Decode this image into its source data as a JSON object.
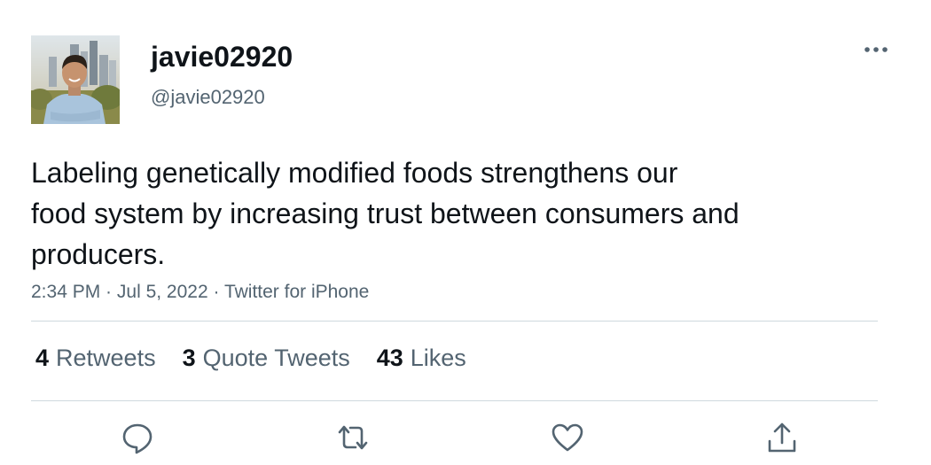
{
  "author": {
    "display_name": "javie02920",
    "handle": "@javie02920"
  },
  "tweet": {
    "text_lines": [
      "Labeling genetically modified foods strengthens our",
      "food system by increasing trust between consumers and",
      "producers."
    ],
    "time": "2:34 PM",
    "date": "Jul 5, 2022",
    "source": "Twitter for iPhone",
    "separator": " · "
  },
  "stats": {
    "retweets": {
      "count": "4",
      "label": "Retweets"
    },
    "quotes": {
      "count": "3",
      "label": "Quote Tweets"
    },
    "likes": {
      "count": "43",
      "label": "Likes"
    }
  },
  "actions": [
    "reply-icon",
    "retweet-icon",
    "like-icon",
    "share-icon"
  ],
  "colors": {
    "text_primary": "#0f1419",
    "text_secondary": "#536471",
    "divider": "#cfd9de",
    "icon": "#536471"
  }
}
